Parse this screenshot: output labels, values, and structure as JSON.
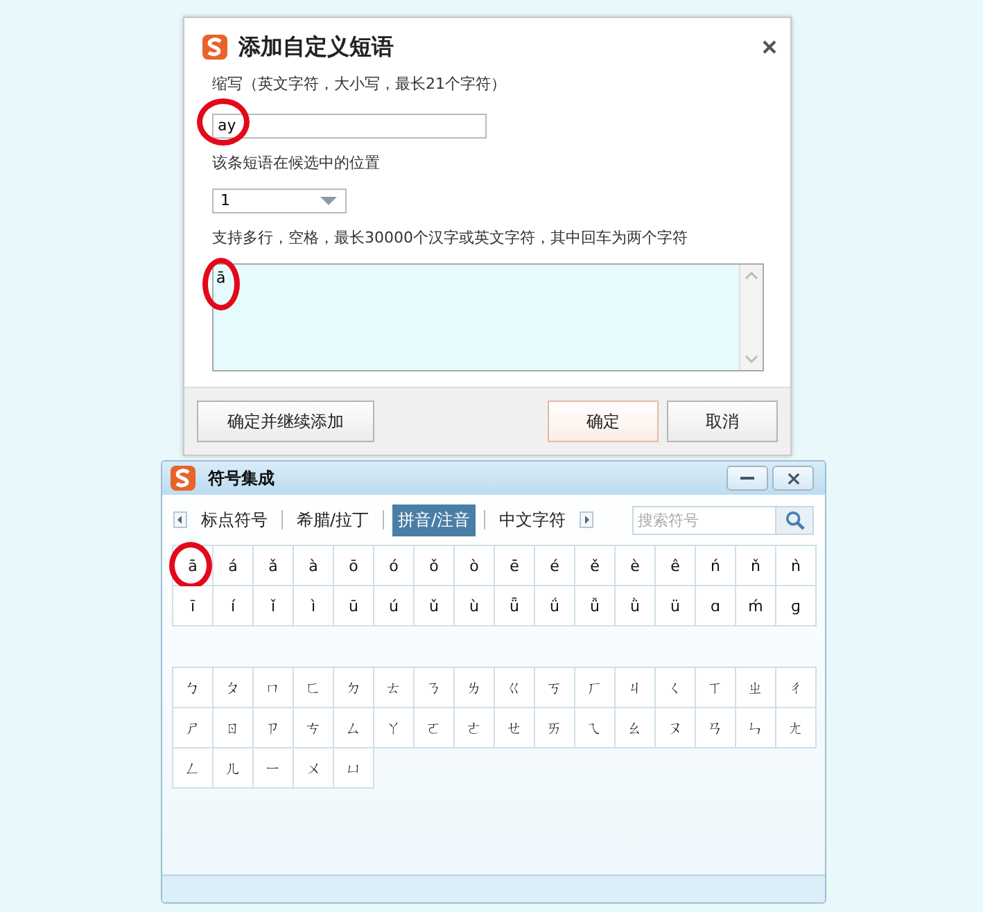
{
  "phrase_dialog": {
    "title": "添加自定义短语",
    "abbr_label": "缩写（英文字符，大小写，最长21个字符）",
    "abbr_value": "ay",
    "abbr_circled": true,
    "position_label": "该条短语在候选中的位置",
    "position_value": "1",
    "content_label": "支持多行，空格，最长30000个汉字或英文字符，其中回车为两个字符",
    "content_value": "ā",
    "content_circled": true,
    "buttons": [
      {
        "label": "确定并继续添加",
        "kind": "plain"
      },
      {
        "label": "确定",
        "kind": "default"
      },
      {
        "label": "取消",
        "kind": "plain"
      }
    ]
  },
  "symbol_window": {
    "title": "符号集成",
    "tabs": [
      {
        "label": "标点符号",
        "selected": false
      },
      {
        "label": "希腊/拉丁",
        "selected": false
      },
      {
        "label": "拼音/注音",
        "selected": true
      },
      {
        "label": "中文字符",
        "selected": false
      }
    ],
    "search": {
      "placeholder": "搜索符号"
    },
    "groups": [
      {
        "symbols": [
          {
            "char": "ā",
            "circled": true
          },
          {
            "char": "á",
            "circled": false
          },
          {
            "char": "ǎ",
            "circled": false
          },
          {
            "char": "à",
            "circled": false
          },
          {
            "char": "ō",
            "circled": false
          },
          {
            "char": "ó",
            "circled": false
          },
          {
            "char": "ǒ",
            "circled": false
          },
          {
            "char": "ò",
            "circled": false
          },
          {
            "char": "ē",
            "circled": false
          },
          {
            "char": "é",
            "circled": false
          },
          {
            "char": "ě",
            "circled": false
          },
          {
            "char": "è",
            "circled": false
          },
          {
            "char": "ê",
            "circled": false
          },
          {
            "char": "ń",
            "circled": false
          },
          {
            "char": "ň",
            "circled": false
          },
          {
            "char": "ǹ",
            "circled": false
          },
          {
            "char": "ī",
            "circled": false
          },
          {
            "char": "í",
            "circled": false
          },
          {
            "char": "ǐ",
            "circled": false
          },
          {
            "char": "ì",
            "circled": false
          },
          {
            "char": "ū",
            "circled": false
          },
          {
            "char": "ú",
            "circled": false
          },
          {
            "char": "ǔ",
            "circled": false
          },
          {
            "char": "ù",
            "circled": false
          },
          {
            "char": "ǖ",
            "circled": false
          },
          {
            "char": "ǘ",
            "circled": false
          },
          {
            "char": "ǚ",
            "circled": false
          },
          {
            "char": "ǜ",
            "circled": false
          },
          {
            "char": "ü",
            "circled": false
          },
          {
            "char": "ɑ",
            "circled": false
          },
          {
            "char": "ḿ",
            "circled": false
          },
          {
            "char": "ɡ",
            "circled": false
          }
        ]
      },
      {
        "symbols": [
          {
            "char": "ㄅ",
            "circled": false
          },
          {
            "char": "ㄆ",
            "circled": false
          },
          {
            "char": "ㄇ",
            "circled": false
          },
          {
            "char": "ㄈ",
            "circled": false
          },
          {
            "char": "ㄉ",
            "circled": false
          },
          {
            "char": "ㄊ",
            "circled": false
          },
          {
            "char": "ㄋ",
            "circled": false
          },
          {
            "char": "ㄌ",
            "circled": false
          },
          {
            "char": "ㄍ",
            "circled": false
          },
          {
            "char": "ㄎ",
            "circled": false
          },
          {
            "char": "ㄏ",
            "circled": false
          },
          {
            "char": "ㄐ",
            "circled": false
          },
          {
            "char": "ㄑ",
            "circled": false
          },
          {
            "char": "ㄒ",
            "circled": false
          },
          {
            "char": "ㄓ",
            "circled": false
          },
          {
            "char": "ㄔ",
            "circled": false
          },
          {
            "char": "ㄕ",
            "circled": false
          },
          {
            "char": "ㄖ",
            "circled": false
          },
          {
            "char": "ㄗ",
            "circled": false
          },
          {
            "char": "ㄘ",
            "circled": false
          },
          {
            "char": "ㄙ",
            "circled": false
          },
          {
            "char": "ㄚ",
            "circled": false
          },
          {
            "char": "ㄛ",
            "circled": false
          },
          {
            "char": "ㄜ",
            "circled": false
          },
          {
            "char": "ㄝ",
            "circled": false
          },
          {
            "char": "ㄞ",
            "circled": false
          },
          {
            "char": "ㄟ",
            "circled": false
          },
          {
            "char": "ㄠ",
            "circled": false
          },
          {
            "char": "ㄡ",
            "circled": false
          },
          {
            "char": "ㄢ",
            "circled": false
          },
          {
            "char": "ㄣ",
            "circled": false
          },
          {
            "char": "ㄤ",
            "circled": false
          },
          {
            "char": "ㄥ",
            "circled": false
          },
          {
            "char": "ㄦ",
            "circled": false
          },
          {
            "char": "ㄧ",
            "circled": false
          },
          {
            "char": "ㄨ",
            "circled": false
          },
          {
            "char": "ㄩ",
            "circled": false
          }
        ]
      }
    ]
  }
}
